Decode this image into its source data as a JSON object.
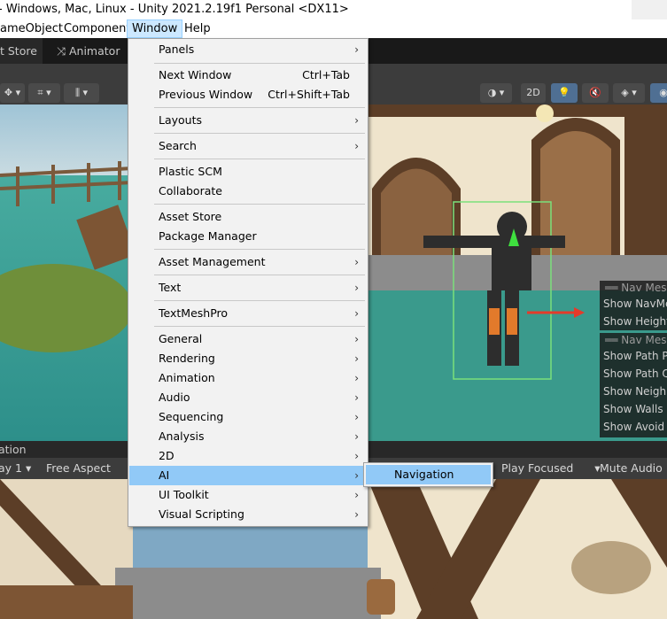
{
  "window_title": "- Windows, Mac, Linux - Unity 2021.2.19f1 Personal <DX11>",
  "menubar": {
    "items": [
      "ameObject",
      "Component",
      "Window",
      "Help"
    ],
    "active": "Window"
  },
  "tabs": [
    "t Store",
    "Animator"
  ],
  "toolbar": {
    "btn_2d": "2D"
  },
  "window_menu": {
    "items": [
      {
        "label": "Panels",
        "shortcut": "",
        "submenu": true
      },
      {
        "label": "Next Window",
        "shortcut": "Ctrl+Tab",
        "submenu": false
      },
      {
        "label": "Previous Window",
        "shortcut": "Ctrl+Shift+Tab",
        "submenu": false
      },
      {
        "label": "Layouts",
        "shortcut": "",
        "submenu": true
      },
      {
        "label": "Search",
        "shortcut": "",
        "submenu": true
      },
      {
        "label": "Plastic SCM",
        "shortcut": "",
        "submenu": false
      },
      {
        "label": "Collaborate",
        "shortcut": "",
        "submenu": false
      },
      {
        "label": "Asset Store",
        "shortcut": "",
        "submenu": false
      },
      {
        "label": "Package Manager",
        "shortcut": "",
        "submenu": false
      },
      {
        "label": "Asset Management",
        "shortcut": "",
        "submenu": true
      },
      {
        "label": "Text",
        "shortcut": "",
        "submenu": true
      },
      {
        "label": "TextMeshPro",
        "shortcut": "",
        "submenu": true
      },
      {
        "label": "General",
        "shortcut": "",
        "submenu": true
      },
      {
        "label": "Rendering",
        "shortcut": "",
        "submenu": true
      },
      {
        "label": "Animation",
        "shortcut": "",
        "submenu": true
      },
      {
        "label": "Audio",
        "shortcut": "",
        "submenu": true
      },
      {
        "label": "Sequencing",
        "shortcut": "",
        "submenu": true
      },
      {
        "label": "Analysis",
        "shortcut": "",
        "submenu": true
      },
      {
        "label": "2D",
        "shortcut": "",
        "submenu": true
      },
      {
        "label": "AI",
        "shortcut": "",
        "submenu": true
      },
      {
        "label": "UI Toolkit",
        "shortcut": "",
        "submenu": true
      },
      {
        "label": "Visual Scripting",
        "shortcut": "",
        "submenu": true
      }
    ],
    "highlighted": "AI"
  },
  "ai_submenu": {
    "items": [
      "Navigation"
    ]
  },
  "nav_mesh_panel": {
    "header": "Nav Mes",
    "rows": [
      "Show NavMe",
      "Show Height"
    ]
  },
  "nav_agent_panel": {
    "header": "Nav Mes",
    "rows": [
      "Show Path P",
      "Show Path Q",
      "Show Neighb",
      "Show Walls",
      "Show Avoid"
    ]
  },
  "game_view": {
    "tab_label": "ation",
    "display": "ay 1",
    "aspect": "Free Aspect",
    "play_focused": "Play Focused",
    "mute_audio": "Mute Audio"
  },
  "colors": {
    "menu_highlight": "#91c9f7",
    "menu_bg": "#f2f2f2",
    "menubar_active": "#cce8ff"
  }
}
